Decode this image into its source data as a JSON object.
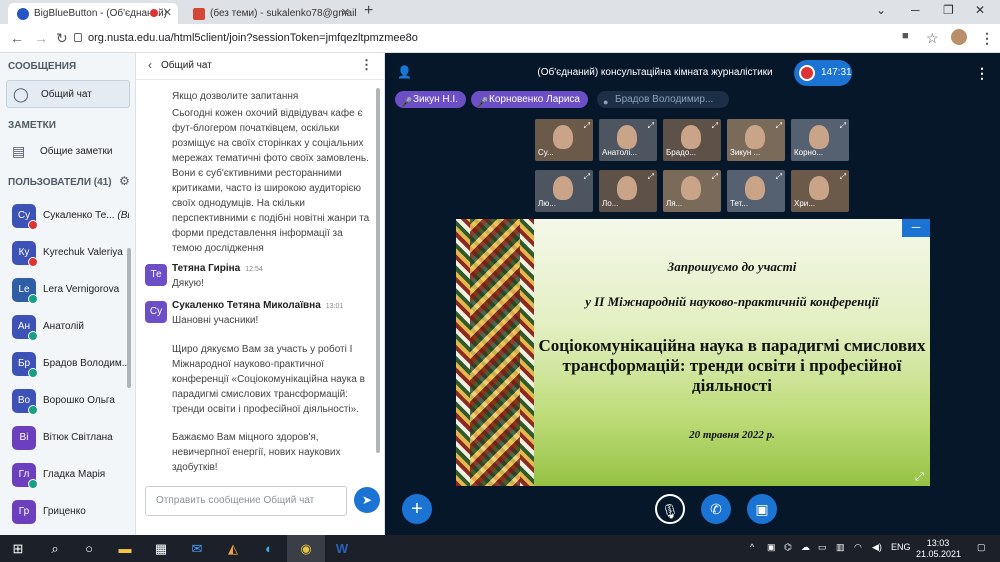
{
  "browser": {
    "tabs": [
      {
        "title": "BigBlueButton - (Об'єднаний)",
        "active": true
      },
      {
        "title": "(без теми) - sukalenko78@gmail",
        "active": false
      }
    ],
    "url": "org.nusta.edu.ua/html5client/join?sessionToken=jmfqezltpmzmee8o"
  },
  "sidebar": {
    "messages_title": "СООБЩЕНИЯ",
    "public_chat": "Общий чат",
    "notes_title": "ЗАМЕТКИ",
    "shared_notes": "Общие заметки",
    "users_title": "ПОЛЬЗОВАТЕЛИ (41)",
    "users": [
      {
        "initials": "Су",
        "name": "Сукаленко Те...",
        "suffix": "(Вы)",
        "color": "#3c52b7",
        "badge": "#d33"
      },
      {
        "initials": "Ку",
        "name": "Kyrechuk Valeriya",
        "color": "#3c52b7",
        "badge": "#d33"
      },
      {
        "initials": "Le",
        "name": "Lera Vernigorova",
        "color": "#2f5da6",
        "badge": "#16a085"
      },
      {
        "initials": "Ан",
        "name": "Анатолій",
        "color": "#3c52b7",
        "badge": "#16a085"
      },
      {
        "initials": "Бр",
        "name": "Брадов Володим...",
        "color": "#3c52b7",
        "badge": "#16a085"
      },
      {
        "initials": "Во",
        "name": "Ворошко Ольга",
        "color": "#3c52b7",
        "badge": "#16a085"
      },
      {
        "initials": "Ві",
        "name": "Вітюк Світлана",
        "color": "#6c3fbf",
        "badge": ""
      },
      {
        "initials": "Гл",
        "name": "Гладка Марія",
        "color": "#6c3fbf",
        "badge": "#16a085"
      },
      {
        "initials": "Гр",
        "name": "Гриценко",
        "color": "#6c3fbf",
        "badge": ""
      }
    ]
  },
  "chat": {
    "title": "Общий чат",
    "messages": [
      {
        "text": "Якщо дозволите запитання"
      },
      {
        "text": "Сьогодні кожен охочий відвідувач кафе є фут-блогером початківцем, оскільки розміщує на своїх сторінках у соціальних мережах тематичні фото своїх замовлень. Вони є суб'єктивними ресторанними критиками, часто із широкою аудиторією своїх однодумців. На скільки перспективними є подібні новітні жанри та форми представлення інформації за темою дослідження"
      },
      {
        "initials": "Те",
        "author": "Тетяна Гиріна",
        "time": "12:54",
        "text": "Дякую!"
      },
      {
        "initials": "Су",
        "author": "Сукаленко Тетяна Миколаївна",
        "time": "13:01",
        "text": "Шановні учасники!"
      },
      {
        "text": "Щиро дякуємо Вам за участь у роботі І Міжнародної науково-практичної конференції «Соціокомунікаційна наука в парадигмі смислових трансформацій: тренди освіти і професійної діяльності»."
      },
      {
        "text": "Бажаємо Вам міцного здоров'я, невичерпної енергії, нових наукових здобутків!"
      }
    ],
    "input_placeholder": "Отправить сообщение Общий чат"
  },
  "main": {
    "room_title": "(Об'єднаний) консультаційна кімната журналістики",
    "timer": "147:31",
    "talkers": [
      "Зикун Н.І.",
      "Корновенко Лариса",
      "Брадов Володимир..."
    ],
    "videos_row1": [
      "Су...",
      "Анатолі...",
      "Брадо...",
      "Зикун ...",
      "Корно..."
    ],
    "videos_row2": [
      "Лю...",
      "Ло...",
      "Ля...",
      "Тет...",
      "Хри..."
    ],
    "slide": {
      "line1": "Запрошуємо до участі",
      "line2": "у ІІ Міжнародній науково-практичній конференції",
      "title": "Соціокомунікаційна наука в парадигмі смислових трансформацій: тренди освіти і професійної діяльності",
      "date": "20 травня 2022 р."
    }
  },
  "taskbar": {
    "lang": "ENG",
    "time": "13:03",
    "date": "21.05.2021"
  }
}
